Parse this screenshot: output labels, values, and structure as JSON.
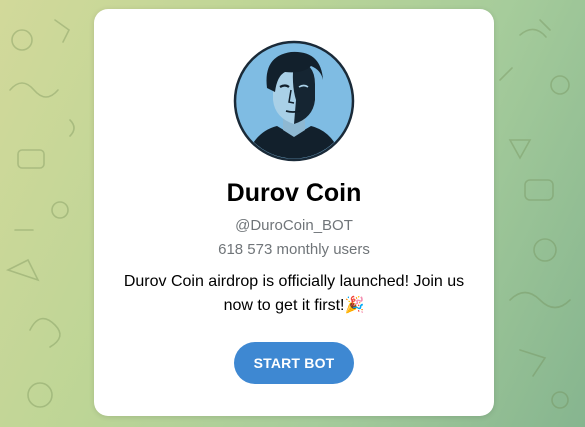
{
  "bot": {
    "name": "Durov Coin",
    "username": "@DuroCoin_BOT",
    "monthly_users": "618 573 monthly users",
    "description": "Durov Coin airdrop is officially launched! Join us now to get it first!🎉"
  },
  "actions": {
    "start_label": "START BOT"
  },
  "icons": {
    "avatar": "portrait-avatar-icon"
  },
  "colors": {
    "button": "#3e88d2",
    "avatar_bg": "#7fbce3",
    "secondary_text": "#707579"
  }
}
